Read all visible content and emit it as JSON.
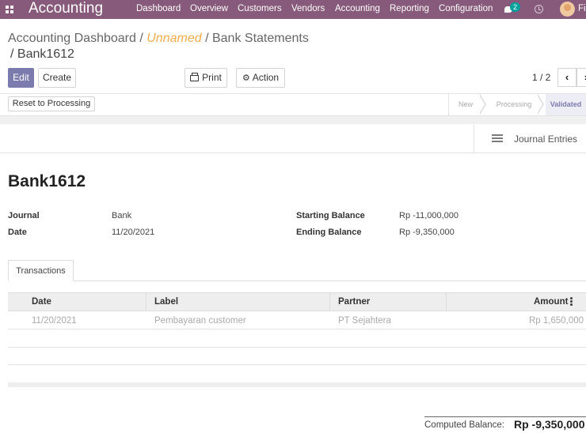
{
  "navbar": {
    "brand": "Accounting",
    "items": [
      "Dashboard",
      "Overview",
      "Customers",
      "Vendors",
      "Accounting",
      "Reporting",
      "Configuration"
    ],
    "chat_badge": "2",
    "user_initial": "Fi",
    "color": "#875a7b"
  },
  "breadcrumb": {
    "part1": "Accounting Dashboard",
    "sep": "/",
    "part2": "Unnamed",
    "part3": "Bank Statements",
    "current": "/ Bank1612"
  },
  "toolbar": {
    "edit_label": "Edit",
    "create_label": "Create",
    "print_label": "Print",
    "action_label": "Action"
  },
  "pager": {
    "text": "1 / 2",
    "prev": "‹",
    "next": "›"
  },
  "header": {
    "reset_label": "Reset to Processing",
    "stages": [
      "New",
      "Processing",
      "Validated"
    ],
    "active_stage": "Validated"
  },
  "smart_button": {
    "label": "Journal Entries",
    "icon": "list-icon"
  },
  "form": {
    "title": "Bank1612",
    "journal_label": "Journal",
    "journal_value": "Bank",
    "date_label": "Date",
    "date_value": "11/20/2021",
    "starting_balance_label": "Starting Balance",
    "starting_balance_value": "Rp -11,000,000",
    "ending_balance_label": "Ending Balance",
    "ending_balance_value": "Rp -9,350,000"
  },
  "transactions": {
    "tab_label": "Transactions",
    "columns": [
      "Date",
      "Label",
      "Partner",
      "Amount"
    ],
    "rows": [
      {
        "date": "11/20/2021",
        "label": "Pembayaran customer",
        "partner": "PT Sejahtera",
        "amount": "Rp 1,650,000"
      }
    ]
  },
  "footer": {
    "computed_label": "Computed Balance:",
    "computed_value": "Rp -9,350,000"
  }
}
